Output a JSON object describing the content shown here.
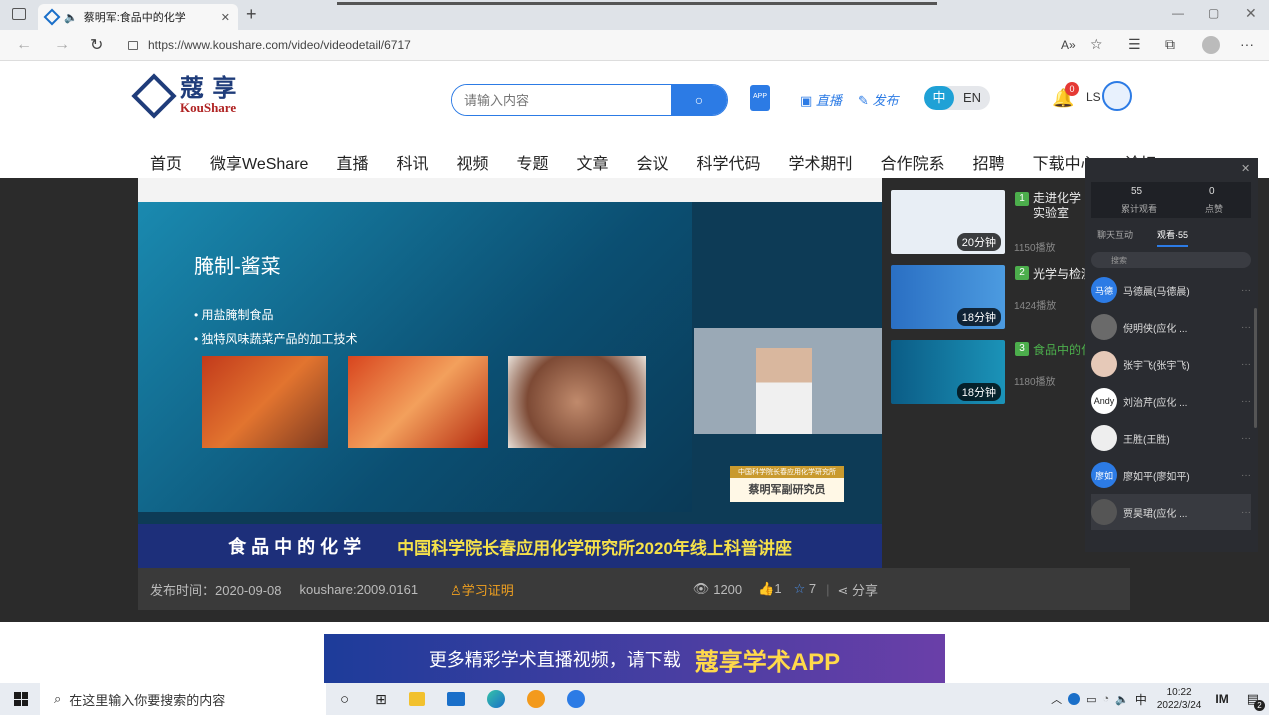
{
  "browser": {
    "tab_title": "蔡明军:食品中的化学",
    "url": "https://www.koushare.com/video/videodetail/6717"
  },
  "site": {
    "logo_cn": "蔻 享",
    "logo_en": "KouShare",
    "search_placeholder": "请输入内容",
    "app_label": "APP",
    "live_label": "直播",
    "publish_label": "发布",
    "lang_cn": "中",
    "lang_en": "EN",
    "notification_count": "0",
    "user_initials": "LS",
    "nav": [
      "首页",
      "微享WeShare",
      "直播",
      "科讯",
      "视频",
      "专题",
      "文章",
      "会议",
      "科学代码",
      "学术期刊",
      "合作院系",
      "招聘",
      "下载中心",
      "论坛"
    ]
  },
  "video": {
    "slide_title": "腌制-酱菜",
    "bullet1": "用盐腌制食品",
    "bullet2": "独特风味蔬菜产品的加工技术",
    "speaker_label_top": "中国科学院长春应用化学研究所",
    "speaker_label": "蔡明军副研究员",
    "banner_left": "食 品 中 的 化 学",
    "banner_right": "中国科学院长春应用化学研究所2020年线上科普讲座",
    "publish_time": "发布时间：2020-09-08",
    "code": "koushare:2009.0161",
    "cert": "学习证明",
    "views": "1200",
    "likes": "1",
    "favorites": "7",
    "share": "分享"
  },
  "recommendations": [
    {
      "num": "1",
      "title": "走进化学实验室",
      "plays": "1150播放",
      "duration": "20分钟"
    },
    {
      "num": "2",
      "title": "光学与检测",
      "plays": "1424播放",
      "duration": "18分钟"
    },
    {
      "num": "3",
      "title": "食品中的化学",
      "plays": "1180播放",
      "duration": "18分钟"
    }
  ],
  "panel": {
    "total_views": "55",
    "total_views_label": "累计观看",
    "likes": "0",
    "likes_label": "点赞",
    "tab_chat": "聊天互动",
    "tab_watch": "观看·55",
    "search_placeholder": "搜索",
    "viewers": [
      {
        "avatar": "马德",
        "name": "马德晨(马德晨)"
      },
      {
        "avatar": "",
        "name": "倪明侠(应化 ..."
      },
      {
        "avatar": "",
        "name": "张宇飞(张宇飞)"
      },
      {
        "avatar": "Andy",
        "name": "刘治芹(应化 ..."
      },
      {
        "avatar": "",
        "name": "王胜(王胜)"
      },
      {
        "avatar": "廖如",
        "name": "廖如平(廖如平)"
      },
      {
        "avatar": "",
        "name": "贾昊珺(应化 ..."
      }
    ]
  },
  "promo": {
    "text": "更多精彩学术直播视频，请下载",
    "app": "蔻享学术APP"
  },
  "taskbar": {
    "search_placeholder": "在这里输入你要搜索的内容",
    "ime": "中",
    "time": "10:22",
    "date": "2022/3/24",
    "notif_count": "2"
  }
}
